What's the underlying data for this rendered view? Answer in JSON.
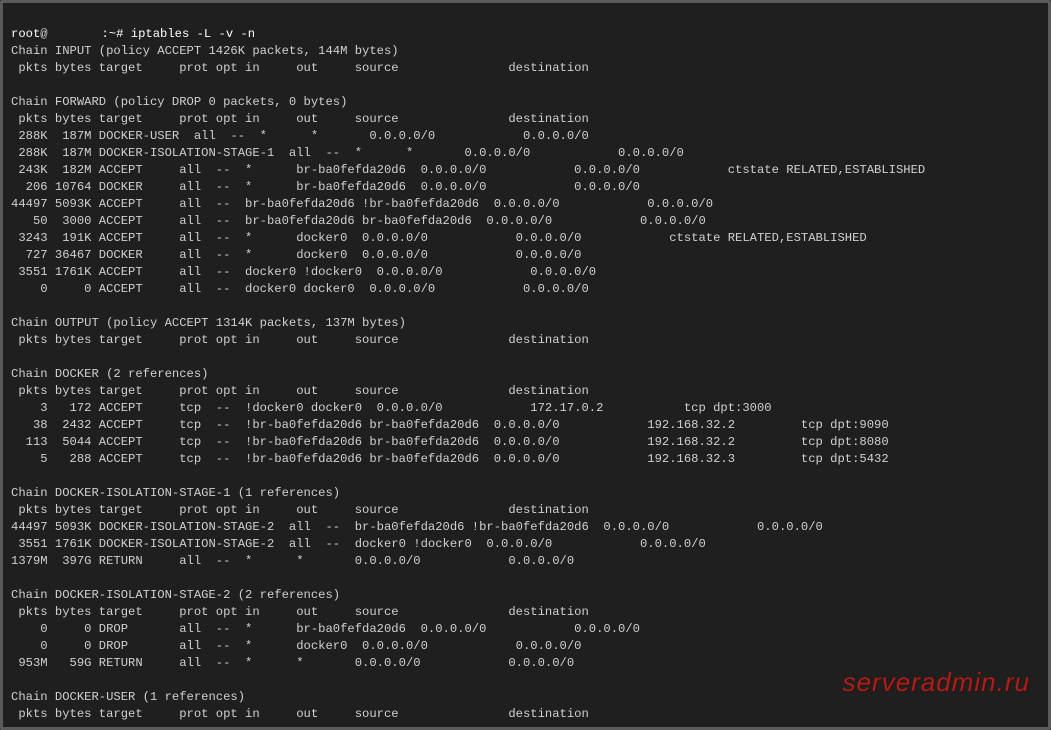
{
  "prompt": {
    "user": "root",
    "at": "@",
    "host_obscured": "     ",
    "colon_tilde": " :~# ",
    "command": "iptables -L -v -n"
  },
  "columns_header": " pkts bytes target     prot opt in     out     source               destination",
  "chains": [
    {
      "name": "INPUT",
      "header": "Chain INPUT (policy ACCEPT 1426K packets, 144M bytes)",
      "rows": []
    },
    {
      "name": "FORWARD",
      "header": "Chain FORWARD (policy DROP 0 packets, 0 bytes)",
      "rows": [
        " 288K  187M DOCKER-USER  all  --  *      *       0.0.0.0/0            0.0.0.0/0",
        " 288K  187M DOCKER-ISOLATION-STAGE-1  all  --  *      *       0.0.0.0/0            0.0.0.0/0",
        " 243K  182M ACCEPT     all  --  *      br-ba0fefda20d6  0.0.0.0/0            0.0.0.0/0            ctstate RELATED,ESTABLISHED",
        "  206 10764 DOCKER     all  --  *      br-ba0fefda20d6  0.0.0.0/0            0.0.0.0/0",
        "44497 5093K ACCEPT     all  --  br-ba0fefda20d6 !br-ba0fefda20d6  0.0.0.0/0            0.0.0.0/0",
        "   50  3000 ACCEPT     all  --  br-ba0fefda20d6 br-ba0fefda20d6  0.0.0.0/0            0.0.0.0/0",
        " 3243  191K ACCEPT     all  --  *      docker0  0.0.0.0/0            0.0.0.0/0            ctstate RELATED,ESTABLISHED",
        "  727 36467 DOCKER     all  --  *      docker0  0.0.0.0/0            0.0.0.0/0",
        " 3551 1761K ACCEPT     all  --  docker0 !docker0  0.0.0.0/0            0.0.0.0/0",
        "    0     0 ACCEPT     all  --  docker0 docker0  0.0.0.0/0            0.0.0.0/0"
      ]
    },
    {
      "name": "OUTPUT",
      "header": "Chain OUTPUT (policy ACCEPT 1314K packets, 137M bytes)",
      "rows": []
    },
    {
      "name": "DOCKER",
      "header": "Chain DOCKER (2 references)",
      "rows": [
        "    3   172 ACCEPT     tcp  --  !docker0 docker0  0.0.0.0/0            172.17.0.2           tcp dpt:3000",
        "   38  2432 ACCEPT     tcp  --  !br-ba0fefda20d6 br-ba0fefda20d6  0.0.0.0/0            192.168.32.2         tcp dpt:9090",
        "  113  5044 ACCEPT     tcp  --  !br-ba0fefda20d6 br-ba0fefda20d6  0.0.0.0/0            192.168.32.2         tcp dpt:8080",
        "    5   288 ACCEPT     tcp  --  !br-ba0fefda20d6 br-ba0fefda20d6  0.0.0.0/0            192.168.32.3         tcp dpt:5432"
      ]
    },
    {
      "name": "DOCKER-ISOLATION-STAGE-1",
      "header": "Chain DOCKER-ISOLATION-STAGE-1 (1 references)",
      "rows": [
        "44497 5093K DOCKER-ISOLATION-STAGE-2  all  --  br-ba0fefda20d6 !br-ba0fefda20d6  0.0.0.0/0            0.0.0.0/0",
        " 3551 1761K DOCKER-ISOLATION-STAGE-2  all  --  docker0 !docker0  0.0.0.0/0            0.0.0.0/0",
        "1379M  397G RETURN     all  --  *      *       0.0.0.0/0            0.0.0.0/0"
      ]
    },
    {
      "name": "DOCKER-ISOLATION-STAGE-2",
      "header": "Chain DOCKER-ISOLATION-STAGE-2 (2 references)",
      "rows": [
        "    0     0 DROP       all  --  *      br-ba0fefda20d6  0.0.0.0/0            0.0.0.0/0",
        "    0     0 DROP       all  --  *      docker0  0.0.0.0/0            0.0.0.0/0",
        " 953M   59G RETURN     all  --  *      *       0.0.0.0/0            0.0.0.0/0"
      ]
    },
    {
      "name": "DOCKER-USER",
      "header": "Chain DOCKER-USER (1 references)",
      "rows": []
    }
  ],
  "watermark": "serveradmin.ru"
}
